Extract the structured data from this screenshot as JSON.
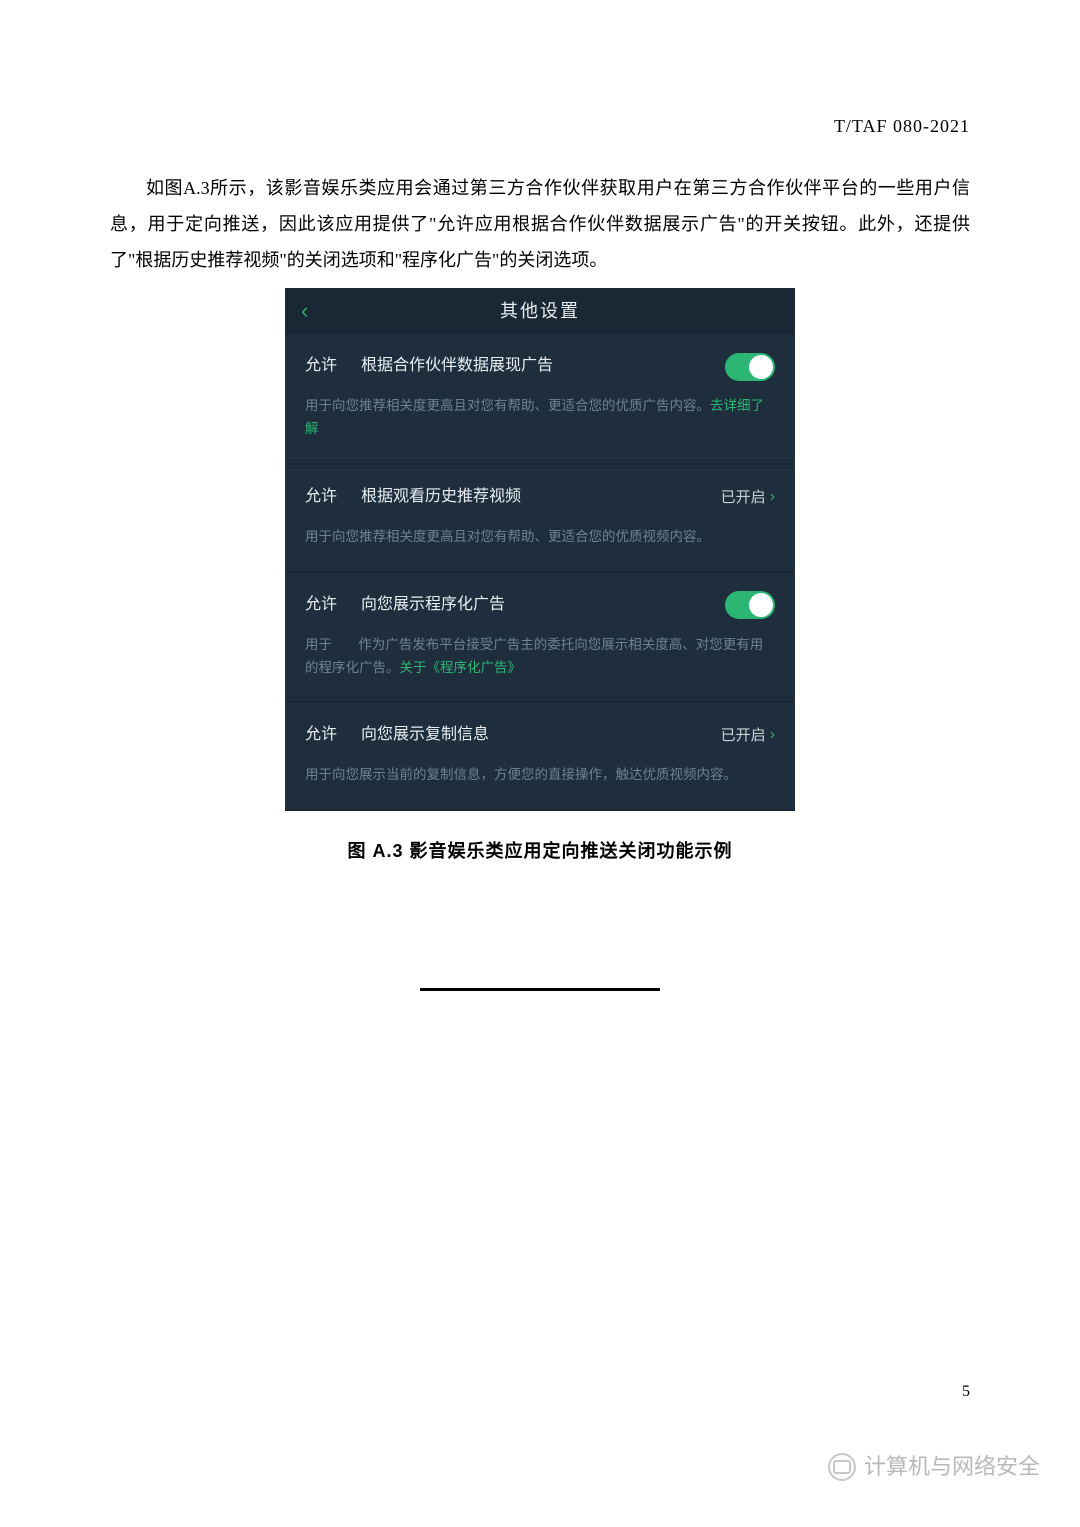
{
  "header_code": "T/TAF 080-2021",
  "paragraph": "如图A.3所示，该影音娱乐类应用会通过第三方合作伙伴获取用户在第三方合作伙伴平台的一些用户信息，用于定向推送，因此该应用提供了\"允许应用根据合作伙伴数据展示广告\"的开关按钮。此外，还提供了\"根据历史推荐视频\"的关闭选项和\"程序化广告\"的关闭选项。",
  "phone": {
    "header_title": "其他设置",
    "allow_label": "允许",
    "settings": [
      {
        "title": "根据合作伙伴数据展现广告",
        "control_type": "toggle",
        "desc_plain": "用于向您推荐相关度更高且对您有帮助、更适合您的优质广告内容。",
        "desc_link": "去详细了解"
      },
      {
        "title": "根据观看历史推荐视频",
        "control_type": "status",
        "status_text": "已开启",
        "desc_plain": "用于向您推荐相关度更高且对您有帮助、更适合您的优质视频内容。"
      },
      {
        "title": "向您展示程序化广告",
        "control_type": "toggle",
        "desc_prefix": "用于",
        "desc_body": "作为广告发布平台接受广告主的委托向您展示相关度高、对您更有用的程序化广告。",
        "desc_link": "关于《程序化广告》"
      },
      {
        "title": "向您展示复制信息",
        "control_type": "status",
        "status_text": "已开启",
        "desc_plain": "用于向您展示当前的复制信息，方便您的直接操作，触达优质视频内容。"
      }
    ]
  },
  "caption": "图 A.3 影音娱乐类应用定向推送关闭功能示例",
  "page_number": "5",
  "watermark_text": "计算机与网络安全"
}
